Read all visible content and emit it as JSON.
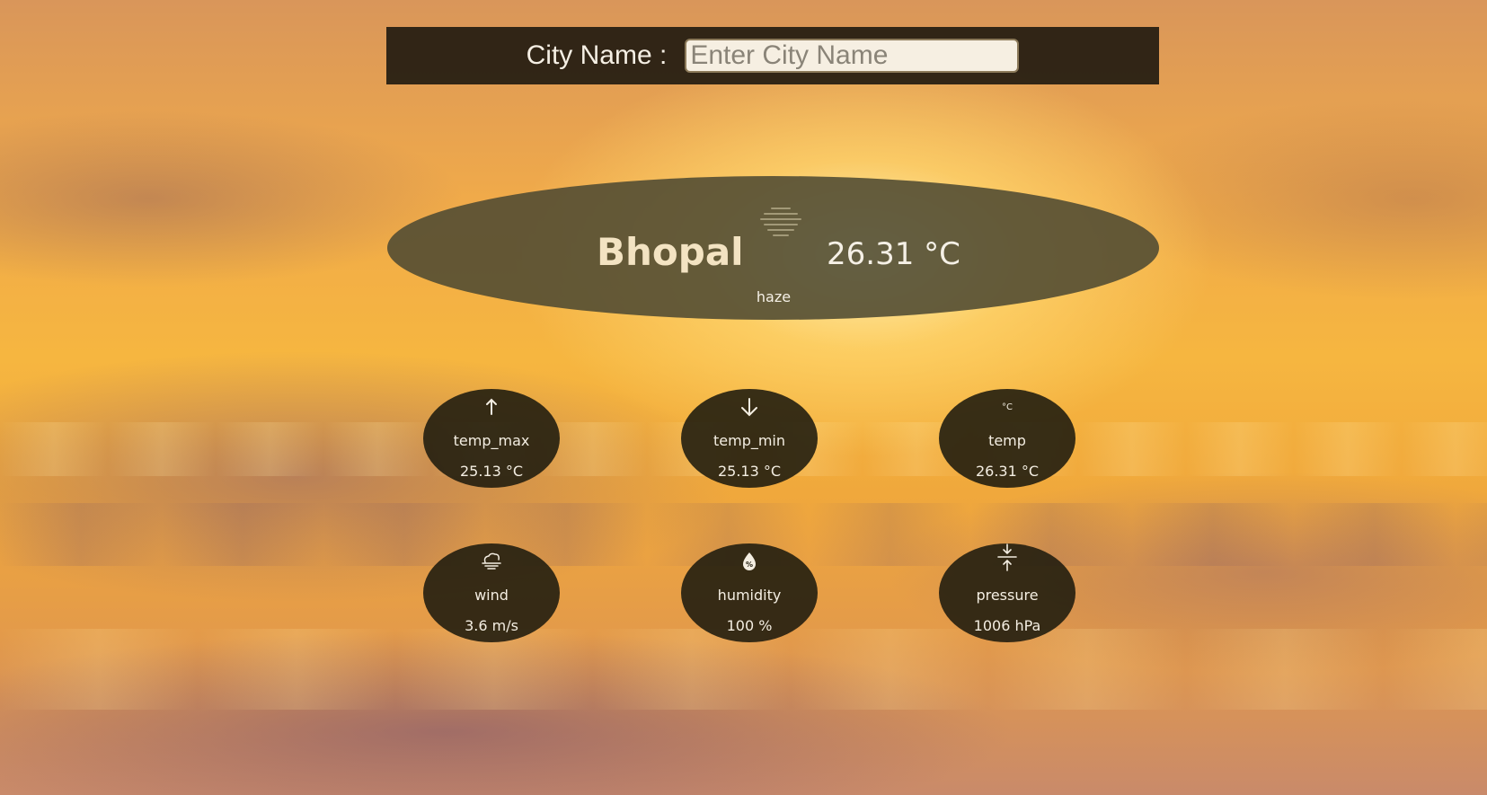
{
  "search": {
    "label": "City Name :",
    "placeholder": "Enter City Name",
    "value": ""
  },
  "current": {
    "city": "Bhopal",
    "temperature": "26.31 °C",
    "condition": "haze",
    "icon": "haze-icon"
  },
  "stats": [
    {
      "label": "temp_max",
      "value": "25.13 °C",
      "icon": "arrow-up-icon"
    },
    {
      "label": "temp_min",
      "value": "25.13 °C",
      "icon": "arrow-down-icon"
    },
    {
      "label": "temp",
      "value": "26.31 °C",
      "icon": "celsius-icon",
      "icon_text": "°C"
    },
    {
      "label": "wind",
      "value": "3.6 m/s",
      "icon": "wind-cloud-icon"
    },
    {
      "label": "humidity",
      "value": "100 %",
      "icon": "humidity-drop-icon"
    },
    {
      "label": "pressure",
      "value": "1006 hPa",
      "icon": "pressure-icon"
    }
  ],
  "colors": {
    "panel": "#1e1810",
    "main_card": "#4e4a32",
    "text": "#f5efe4",
    "city_text": "#f3e3c2"
  }
}
